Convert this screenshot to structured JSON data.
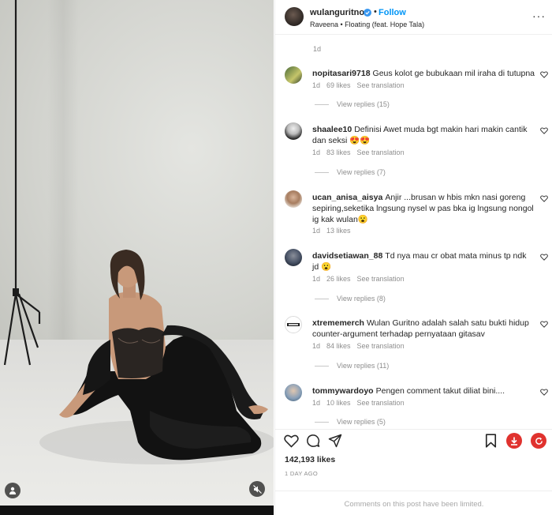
{
  "post": {
    "username": "wulanguritno",
    "follow_label": "Follow",
    "audio": "Raveena • Floating (feat. Hope Tala)",
    "age_top": "1d",
    "likes": "142,193 likes",
    "date": "1 DAY AGO",
    "comments_limited": "Comments on this post have been limited."
  },
  "comments": [
    {
      "user": "nopitasari9718",
      "text": "Geus kolot ge bubukaan mil iraha di tutupna",
      "age": "1d",
      "likes": "69 likes",
      "translate": "See translation",
      "replies": "View replies (15)"
    },
    {
      "user": "shaalee10",
      "text": "Definisi Awet muda bgt makin hari makin cantik dan seksi 😍😍",
      "age": "1d",
      "likes": "83 likes",
      "translate": "See translation",
      "replies": "View replies (7)"
    },
    {
      "user": "ucan_anisa_aisya",
      "text": "Anjir ...brusan w hbis mkn nasi goreng sepiring,seketika lngsung nysel w pas bka ig lngsung nongol ig kak wulan😮",
      "age": "1d",
      "likes": "13 likes",
      "translate": "",
      "replies": ""
    },
    {
      "user": "davidsetiawan_88",
      "text": "Td nya mau cr obat mata minus tp ndk jd 😮",
      "age": "1d",
      "likes": "26 likes",
      "translate": "See translation",
      "replies": "View replies (8)"
    },
    {
      "user": "xtrememerch",
      "text": "Wulan Guritno adalah salah satu bukti hidup counter-argument terhadap pernyataan gitasav",
      "age": "1d",
      "likes": "84 likes",
      "translate": "See translation",
      "replies": "View replies (11)"
    },
    {
      "user": "tommywardoyo",
      "text": "Pengen comment takut diliat bini....",
      "age": "1d",
      "likes": "10 likes",
      "translate": "See translation",
      "replies": "View replies (5)"
    }
  ],
  "icons": {
    "like": "heart-icon",
    "comment": "comment-icon",
    "share": "share-icon",
    "save": "bookmark-icon",
    "download": "download-icon",
    "refresh": "refresh-icon"
  },
  "colors": {
    "link": "#0095f6",
    "verified": "#3897f0",
    "download": "#e0322e",
    "refresh": "#e0322e"
  }
}
